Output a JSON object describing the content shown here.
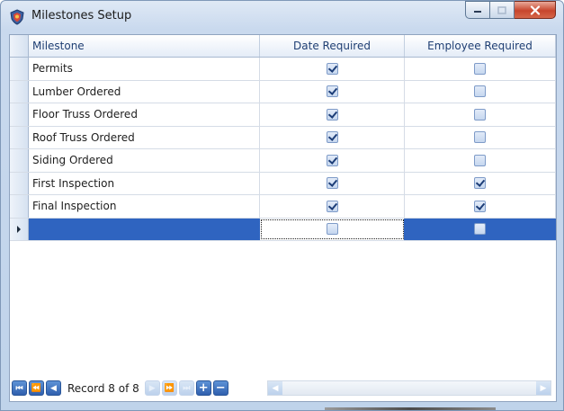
{
  "window": {
    "title": "Milestones Setup",
    "icons": {
      "app": "shield-app-icon",
      "minimize": "minimize-icon",
      "maximize": "maximize-icon",
      "close": "close-icon"
    }
  },
  "grid": {
    "columns": [
      "Milestone",
      "Date Required",
      "Employee Required"
    ],
    "rows": [
      {
        "milestone": "Permits",
        "date_required": true,
        "employee_required": false
      },
      {
        "milestone": "Lumber Ordered",
        "date_required": true,
        "employee_required": false
      },
      {
        "milestone": "Floor Truss Ordered",
        "date_required": true,
        "employee_required": false
      },
      {
        "milestone": "Roof Truss Ordered",
        "date_required": true,
        "employee_required": false
      },
      {
        "milestone": "Siding Ordered",
        "date_required": true,
        "employee_required": false
      },
      {
        "milestone": "First Inspection",
        "date_required": true,
        "employee_required": true
      },
      {
        "milestone": "Final Inspection",
        "date_required": true,
        "employee_required": true
      }
    ],
    "new_row": {
      "milestone": "",
      "date_required": false,
      "employee_required": false
    }
  },
  "navigator": {
    "record_text": "Record 8 of 8",
    "buttons": [
      {
        "name": "first-record-button",
        "icon": "first-icon",
        "enabled": true
      },
      {
        "name": "previous-page-button",
        "icon": "previous-page-icon",
        "enabled": true
      },
      {
        "name": "previous-record-button",
        "icon": "previous-icon",
        "enabled": true
      },
      {
        "name": "next-record-button",
        "icon": "next-icon",
        "enabled": false
      },
      {
        "name": "next-page-button",
        "icon": "next-page-icon",
        "enabled": false
      },
      {
        "name": "last-record-button",
        "icon": "last-icon",
        "enabled": false
      },
      {
        "name": "append-record-button",
        "icon": "plus-icon",
        "enabled": true
      },
      {
        "name": "delete-record-button",
        "icon": "minus-icon",
        "enabled": true
      }
    ]
  },
  "colors": {
    "selection": "#2f64c0",
    "header_text": "#1f3f73",
    "checkbox_border": "#7e9bc8"
  }
}
